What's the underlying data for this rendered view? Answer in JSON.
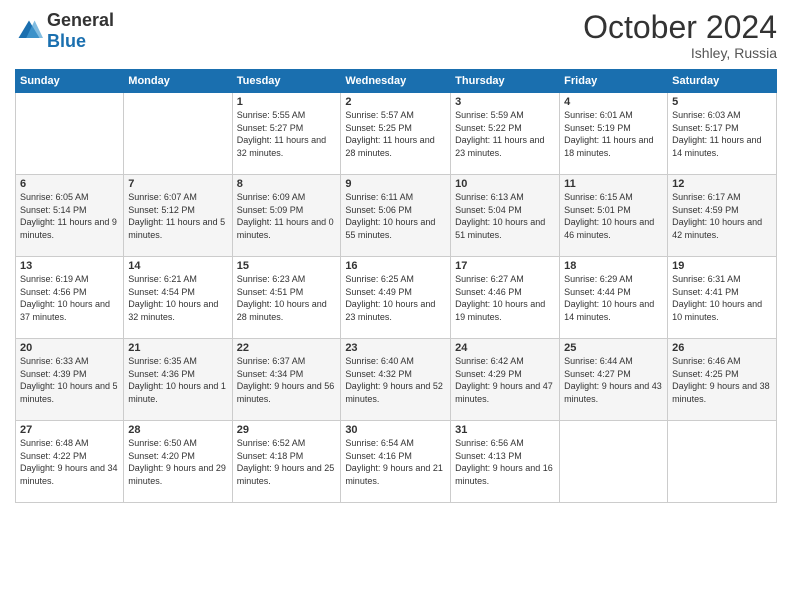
{
  "logo": {
    "general": "General",
    "blue": "Blue"
  },
  "title": {
    "month_year": "October 2024",
    "location": "Ishley, Russia"
  },
  "days_of_week": [
    "Sunday",
    "Monday",
    "Tuesday",
    "Wednesday",
    "Thursday",
    "Friday",
    "Saturday"
  ],
  "weeks": [
    [
      {
        "day": "",
        "sunrise": "",
        "sunset": "",
        "daylight": ""
      },
      {
        "day": "",
        "sunrise": "",
        "sunset": "",
        "daylight": ""
      },
      {
        "day": "1",
        "sunrise": "Sunrise: 5:55 AM",
        "sunset": "Sunset: 5:27 PM",
        "daylight": "Daylight: 11 hours and 32 minutes."
      },
      {
        "day": "2",
        "sunrise": "Sunrise: 5:57 AM",
        "sunset": "Sunset: 5:25 PM",
        "daylight": "Daylight: 11 hours and 28 minutes."
      },
      {
        "day": "3",
        "sunrise": "Sunrise: 5:59 AM",
        "sunset": "Sunset: 5:22 PM",
        "daylight": "Daylight: 11 hours and 23 minutes."
      },
      {
        "day": "4",
        "sunrise": "Sunrise: 6:01 AM",
        "sunset": "Sunset: 5:19 PM",
        "daylight": "Daylight: 11 hours and 18 minutes."
      },
      {
        "day": "5",
        "sunrise": "Sunrise: 6:03 AM",
        "sunset": "Sunset: 5:17 PM",
        "daylight": "Daylight: 11 hours and 14 minutes."
      }
    ],
    [
      {
        "day": "6",
        "sunrise": "Sunrise: 6:05 AM",
        "sunset": "Sunset: 5:14 PM",
        "daylight": "Daylight: 11 hours and 9 minutes."
      },
      {
        "day": "7",
        "sunrise": "Sunrise: 6:07 AM",
        "sunset": "Sunset: 5:12 PM",
        "daylight": "Daylight: 11 hours and 5 minutes."
      },
      {
        "day": "8",
        "sunrise": "Sunrise: 6:09 AM",
        "sunset": "Sunset: 5:09 PM",
        "daylight": "Daylight: 11 hours and 0 minutes."
      },
      {
        "day": "9",
        "sunrise": "Sunrise: 6:11 AM",
        "sunset": "Sunset: 5:06 PM",
        "daylight": "Daylight: 10 hours and 55 minutes."
      },
      {
        "day": "10",
        "sunrise": "Sunrise: 6:13 AM",
        "sunset": "Sunset: 5:04 PM",
        "daylight": "Daylight: 10 hours and 51 minutes."
      },
      {
        "day": "11",
        "sunrise": "Sunrise: 6:15 AM",
        "sunset": "Sunset: 5:01 PM",
        "daylight": "Daylight: 10 hours and 46 minutes."
      },
      {
        "day": "12",
        "sunrise": "Sunrise: 6:17 AM",
        "sunset": "Sunset: 4:59 PM",
        "daylight": "Daylight: 10 hours and 42 minutes."
      }
    ],
    [
      {
        "day": "13",
        "sunrise": "Sunrise: 6:19 AM",
        "sunset": "Sunset: 4:56 PM",
        "daylight": "Daylight: 10 hours and 37 minutes."
      },
      {
        "day": "14",
        "sunrise": "Sunrise: 6:21 AM",
        "sunset": "Sunset: 4:54 PM",
        "daylight": "Daylight: 10 hours and 32 minutes."
      },
      {
        "day": "15",
        "sunrise": "Sunrise: 6:23 AM",
        "sunset": "Sunset: 4:51 PM",
        "daylight": "Daylight: 10 hours and 28 minutes."
      },
      {
        "day": "16",
        "sunrise": "Sunrise: 6:25 AM",
        "sunset": "Sunset: 4:49 PM",
        "daylight": "Daylight: 10 hours and 23 minutes."
      },
      {
        "day": "17",
        "sunrise": "Sunrise: 6:27 AM",
        "sunset": "Sunset: 4:46 PM",
        "daylight": "Daylight: 10 hours and 19 minutes."
      },
      {
        "day": "18",
        "sunrise": "Sunrise: 6:29 AM",
        "sunset": "Sunset: 4:44 PM",
        "daylight": "Daylight: 10 hours and 14 minutes."
      },
      {
        "day": "19",
        "sunrise": "Sunrise: 6:31 AM",
        "sunset": "Sunset: 4:41 PM",
        "daylight": "Daylight: 10 hours and 10 minutes."
      }
    ],
    [
      {
        "day": "20",
        "sunrise": "Sunrise: 6:33 AM",
        "sunset": "Sunset: 4:39 PM",
        "daylight": "Daylight: 10 hours and 5 minutes."
      },
      {
        "day": "21",
        "sunrise": "Sunrise: 6:35 AM",
        "sunset": "Sunset: 4:36 PM",
        "daylight": "Daylight: 10 hours and 1 minute."
      },
      {
        "day": "22",
        "sunrise": "Sunrise: 6:37 AM",
        "sunset": "Sunset: 4:34 PM",
        "daylight": "Daylight: 9 hours and 56 minutes."
      },
      {
        "day": "23",
        "sunrise": "Sunrise: 6:40 AM",
        "sunset": "Sunset: 4:32 PM",
        "daylight": "Daylight: 9 hours and 52 minutes."
      },
      {
        "day": "24",
        "sunrise": "Sunrise: 6:42 AM",
        "sunset": "Sunset: 4:29 PM",
        "daylight": "Daylight: 9 hours and 47 minutes."
      },
      {
        "day": "25",
        "sunrise": "Sunrise: 6:44 AM",
        "sunset": "Sunset: 4:27 PM",
        "daylight": "Daylight: 9 hours and 43 minutes."
      },
      {
        "day": "26",
        "sunrise": "Sunrise: 6:46 AM",
        "sunset": "Sunset: 4:25 PM",
        "daylight": "Daylight: 9 hours and 38 minutes."
      }
    ],
    [
      {
        "day": "27",
        "sunrise": "Sunrise: 6:48 AM",
        "sunset": "Sunset: 4:22 PM",
        "daylight": "Daylight: 9 hours and 34 minutes."
      },
      {
        "day": "28",
        "sunrise": "Sunrise: 6:50 AM",
        "sunset": "Sunset: 4:20 PM",
        "daylight": "Daylight: 9 hours and 29 minutes."
      },
      {
        "day": "29",
        "sunrise": "Sunrise: 6:52 AM",
        "sunset": "Sunset: 4:18 PM",
        "daylight": "Daylight: 9 hours and 25 minutes."
      },
      {
        "day": "30",
        "sunrise": "Sunrise: 6:54 AM",
        "sunset": "Sunset: 4:16 PM",
        "daylight": "Daylight: 9 hours and 21 minutes."
      },
      {
        "day": "31",
        "sunrise": "Sunrise: 6:56 AM",
        "sunset": "Sunset: 4:13 PM",
        "daylight": "Daylight: 9 hours and 16 minutes."
      },
      {
        "day": "",
        "sunrise": "",
        "sunset": "",
        "daylight": ""
      },
      {
        "day": "",
        "sunrise": "",
        "sunset": "",
        "daylight": ""
      }
    ]
  ]
}
